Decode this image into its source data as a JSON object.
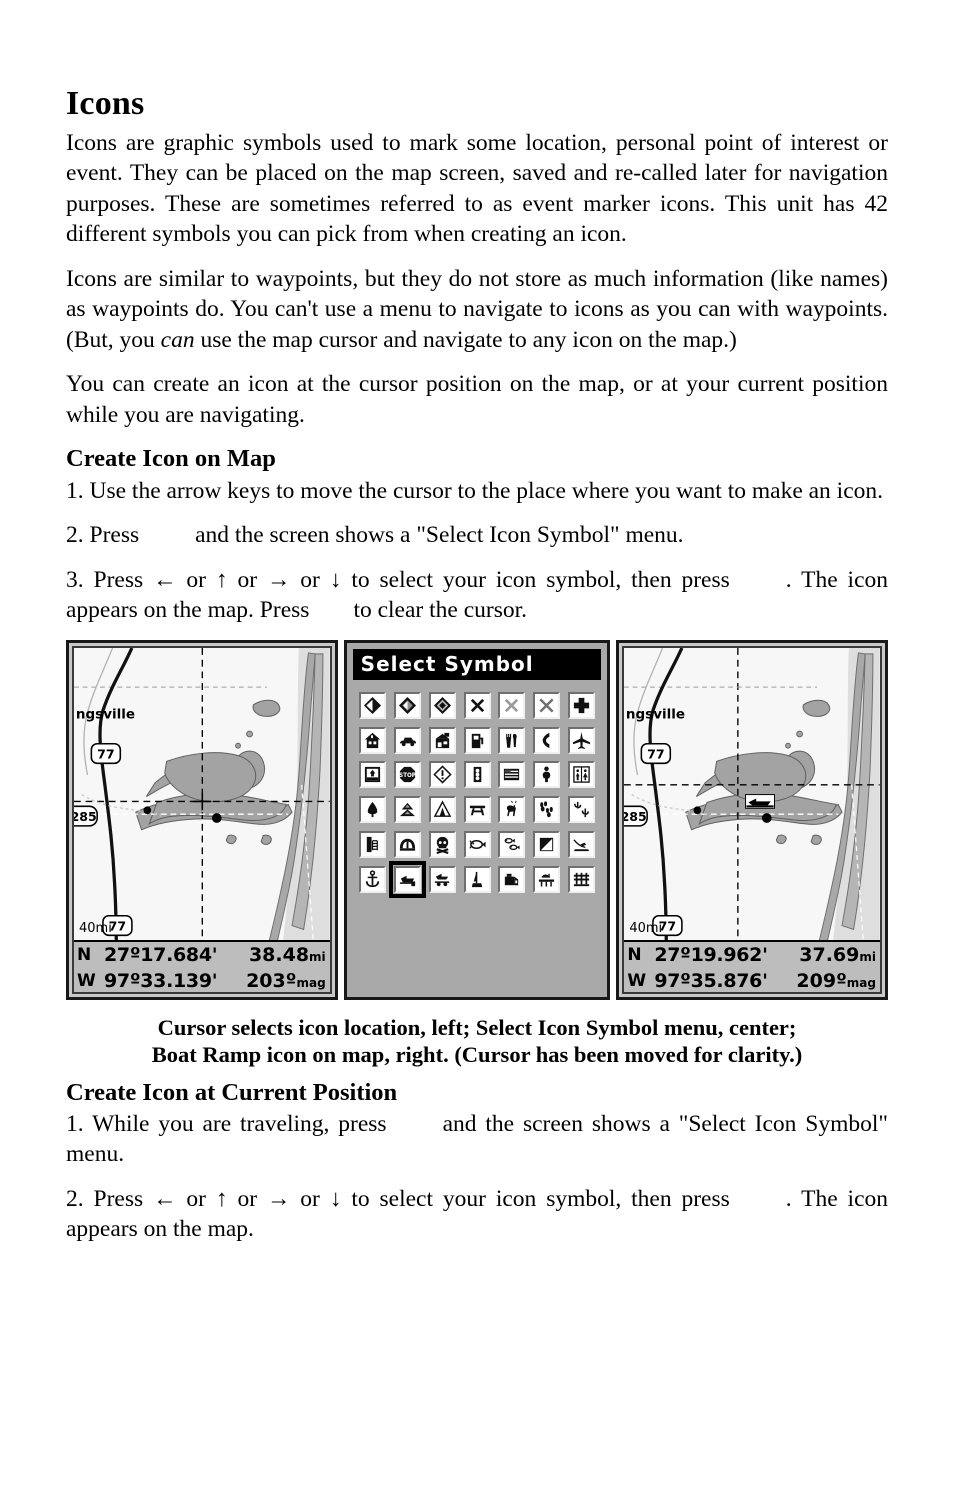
{
  "page": {
    "heading": "Icons",
    "paragraphs": [
      "Icons are graphic symbols used to mark some location, personal point of interest or event. They can be placed on the map screen, saved and re-called later for navigation purposes. These are sometimes referred to as event marker icons. This unit has 42 different symbols you can pick from when creating an icon.",
      "Icons are similar to waypoints, but they do not store as much information (like names) as waypoints do. You can't use a menu to navigate to icons as you can with waypoints. (But, you ",
      " use the map cursor and navigate to any icon on the map.)",
      "You can create an icon at the cursor position on the map, or at your current position while you are navigating."
    ],
    "emphasis_word": "can"
  },
  "section_map": {
    "heading": "Create Icon on Map",
    "step1": "1. Use the arrow keys to move the cursor to the place where you want to make an icon.",
    "step2_a": "2. Press",
    "step2_b": "and the screen shows a \"Select Icon Symbol\" menu.",
    "step3_a": "3. Press ← or ↑ or → or ↓ to select your icon symbol, then press",
    "step3_b": ".",
    "step3_c": "The icon appears on the map. Press",
    "step3_d": "to clear the cursor."
  },
  "section_current": {
    "heading": "Create Icon at Current Position",
    "step1_a": "1. While you are traveling, press",
    "step1_b": "and the screen shows a \"Select Icon Symbol\" menu.",
    "step2_a": "2. Press ← or ↑ or → or ↓ to select your icon symbol, then press",
    "step2_b": ".",
    "step2_c": "The icon appears on the map."
  },
  "caption": {
    "line1": "Cursor selects icon location, left; Select Icon Symbol menu, center;",
    "line2": "Boat Ramp icon on map, right. (Cursor has been moved for clarity.)"
  },
  "map_left": {
    "city_label": "ngsville",
    "highway_shield_top": "77",
    "highway_shield_bottom": "77",
    "highway_shield_left": "285",
    "scale": "40mi",
    "lat_hemisphere": "N",
    "lon_hemisphere": "W",
    "latitude": "27º17.684'",
    "longitude": "97º33.139'",
    "distance": "38.48",
    "distance_unit": "mi",
    "bearing": "203º",
    "bearing_unit": "mag"
  },
  "map_right": {
    "city_label": "ngsville",
    "highway_shield_top": "77",
    "highway_shield_bottom": "77",
    "highway_shield_left": "285",
    "scale": "40mi",
    "lat_hemisphere": "N",
    "lon_hemisphere": "W",
    "latitude": "27º19.962'",
    "longitude": "97º35.876'",
    "distance": "37.69",
    "distance_unit": "mi",
    "bearing": "209º",
    "bearing_unit": "mag"
  },
  "symbol_menu": {
    "title": "Select Symbol",
    "selected_index": 36,
    "selected_name": "boat-ramp",
    "symbols": [
      {
        "name": "diamond-filled-icon"
      },
      {
        "name": "diamond-half-icon"
      },
      {
        "name": "diamond-outline-icon"
      },
      {
        "name": "x-mark-solid-icon"
      },
      {
        "name": "x-mark-hatched-icon"
      },
      {
        "name": "x-mark-thin-icon"
      },
      {
        "name": "cross-plus-icon"
      },
      {
        "name": "house-icon"
      },
      {
        "name": "car-icon"
      },
      {
        "name": "store-icon"
      },
      {
        "name": "fuel-pump-icon"
      },
      {
        "name": "restaurant-icon"
      },
      {
        "name": "telephone-icon"
      },
      {
        "name": "airplane-icon"
      },
      {
        "name": "exit-sign-icon"
      },
      {
        "name": "stop-sign-icon"
      },
      {
        "name": "warning-icon"
      },
      {
        "name": "traffic-light-icon"
      },
      {
        "name": "flag-icon"
      },
      {
        "name": "person-icon"
      },
      {
        "name": "restroom-icon"
      },
      {
        "name": "tree-icon"
      },
      {
        "name": "mountains-icon"
      },
      {
        "name": "tent-icon"
      },
      {
        "name": "picnic-table-icon"
      },
      {
        "name": "deer-icon"
      },
      {
        "name": "animal-tracks-icon"
      },
      {
        "name": "cactus-icon"
      },
      {
        "name": "oil-rig-icon"
      },
      {
        "name": "bridge-icon"
      },
      {
        "name": "danger-skull-icon"
      },
      {
        "name": "fish-icon"
      },
      {
        "name": "two-fish-icon"
      },
      {
        "name": "dive-flag-icon"
      },
      {
        "name": "water-skier-icon"
      },
      {
        "name": "anchor-icon"
      },
      {
        "name": "boat-ramp-icon"
      },
      {
        "name": "boat-trailer-icon"
      },
      {
        "name": "buoy-marker-icon"
      },
      {
        "name": "tackle-box-icon"
      },
      {
        "name": "dock-icon"
      },
      {
        "name": "pier-icon"
      }
    ]
  }
}
